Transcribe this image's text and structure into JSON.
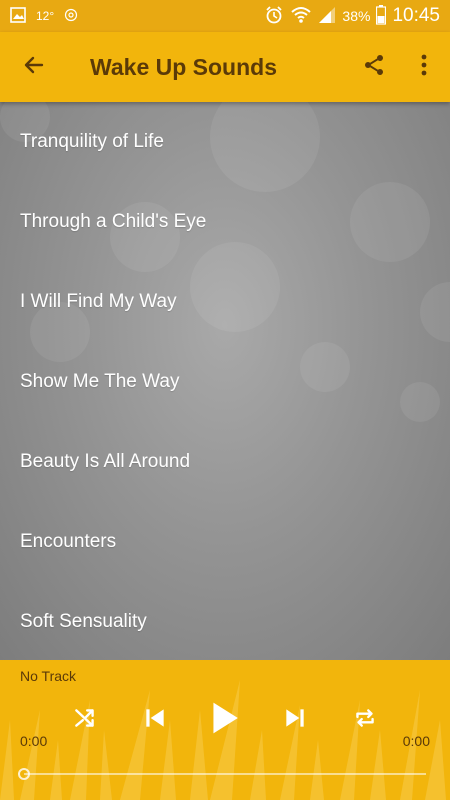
{
  "status_bar": {
    "temperature": "12°",
    "battery_percent": "38%",
    "time": "10:45"
  },
  "app_bar": {
    "title": "Wake Up Sounds",
    "back_icon": "arrow-left-icon",
    "share_icon": "share-icon",
    "more_icon": "more-vert-icon"
  },
  "tracks": [
    {
      "title": "Tranquility of Life"
    },
    {
      "title": "Through a Child's Eye"
    },
    {
      "title": "I Will Find My Way"
    },
    {
      "title": "Show Me The Way"
    },
    {
      "title": "Beauty Is All Around"
    },
    {
      "title": "Encounters"
    },
    {
      "title": "Soft Sensuality"
    }
  ],
  "player": {
    "now_playing": "No Track",
    "elapsed": "0:00",
    "duration": "0:00",
    "progress": 0,
    "controls": [
      "shuffle-icon",
      "skip-previous-icon",
      "play-icon",
      "skip-next-icon",
      "repeat-icon"
    ]
  },
  "colors": {
    "accent": "#f2b50c",
    "status_bar": "#e8a912",
    "title_text": "#5b3a08"
  }
}
